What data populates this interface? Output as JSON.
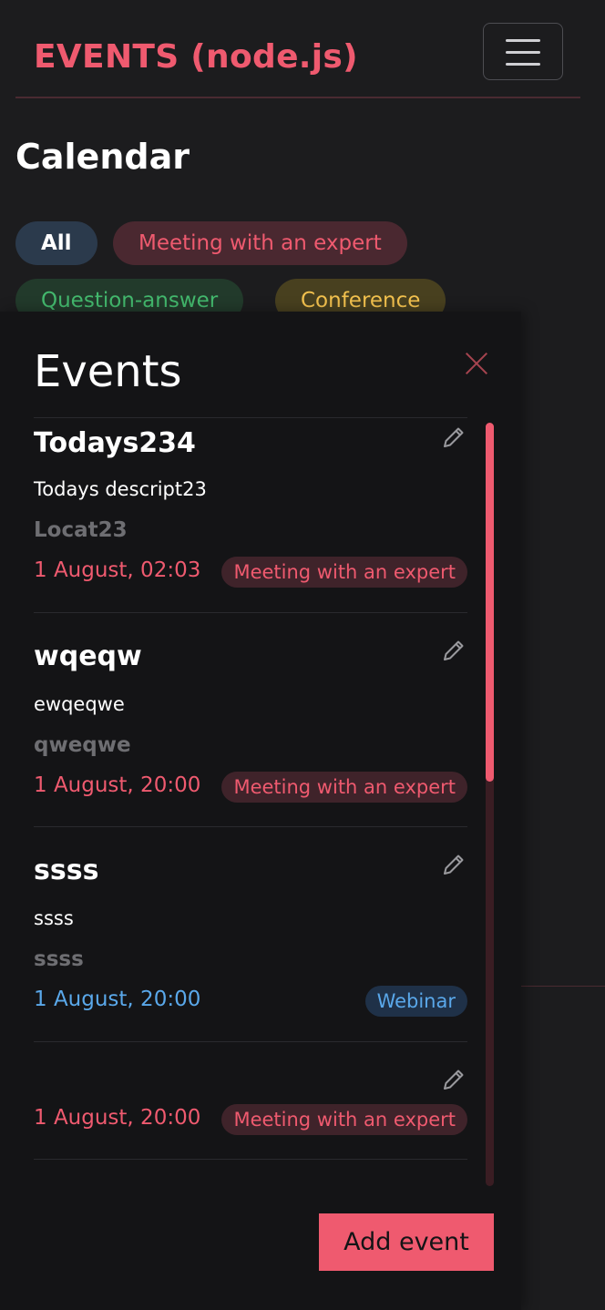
{
  "navbar": {
    "brand": "EVENTS (node.js)",
    "menu_icon": "hamburger-menu-icon"
  },
  "calendar": {
    "title": "Calendar",
    "filters": [
      {
        "label": "All"
      },
      {
        "label": "Meeting with an expert"
      },
      {
        "label": "Question-answer"
      },
      {
        "label": "Conference"
      }
    ]
  },
  "offcanvas": {
    "title": "Events",
    "close_icon": "close-icon",
    "add_button": "Add event",
    "events": [
      {
        "title": "Todays234",
        "description": "Todays descript23",
        "location": "Locat23",
        "date": "1 August, 02:03",
        "category": "Meeting with an expert",
        "edit_icon": "pencil-icon"
      },
      {
        "title": "wqeqw",
        "description": "ewqeqwe",
        "location": "qweqwe",
        "date": "1 August, 20:00",
        "category": "Meeting with an expert",
        "edit_icon": "pencil-icon"
      },
      {
        "title": "ssss",
        "description": "ssss",
        "location": "ssss",
        "date": "1 August, 20:00",
        "category": "Webinar",
        "edit_icon": "pencil-icon"
      },
      {
        "title": "",
        "description": "",
        "location": "",
        "date": "1 August, 20:00",
        "category": "Meeting with an expert",
        "edit_icon": "pencil-icon"
      }
    ]
  },
  "colors": {
    "accent": "#ef5a6f",
    "webinar": "#5aa8ea",
    "question_answer": "#43b86d",
    "conference": "#f2c14e",
    "background": "#1c1c1e",
    "panel": "#141416"
  }
}
